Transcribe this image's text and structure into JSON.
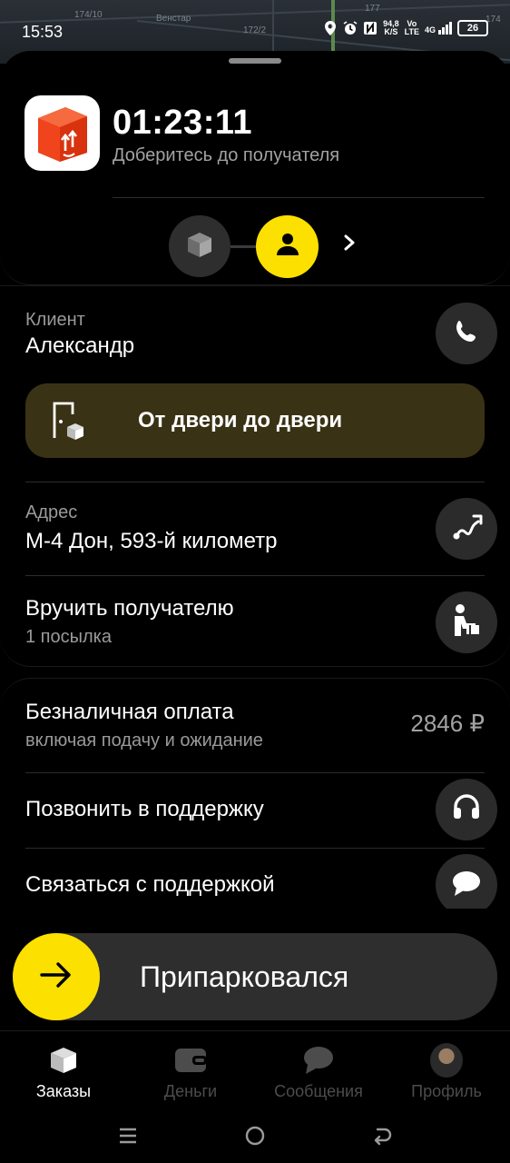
{
  "status_bar": {
    "time": "15:53",
    "map_labels": [
      "174/10",
      "Венстар",
      "172/2",
      "177",
      "174"
    ],
    "speed_value": "94,8",
    "speed_unit": "K/S",
    "volte_top": "Vo",
    "volte_bottom": "LTE",
    "network": "4G",
    "battery": "26",
    "icons": [
      "location-icon",
      "alarm-icon",
      "nfc-icon",
      "signal-icon",
      "battery-icon"
    ]
  },
  "order": {
    "timer": "01:23:11",
    "subtitle": "Доберитесь до получателя",
    "steps": [
      "box-icon",
      "user-icon"
    ]
  },
  "client": {
    "label": "Клиент",
    "name": "Александр",
    "door_to_door": "От двери до двери",
    "address_label": "Адрес",
    "address": "М-4 Дон, 593-й километр",
    "handover_title": "Вручить получателю",
    "handover_sub": "1 посылка"
  },
  "payment": {
    "title": "Безналичная оплата",
    "subtitle": "включая подачу и ожидание",
    "price": "2846 ₽",
    "call_support": "Позвонить в поддержку",
    "chat_support": "Связаться с поддержкой"
  },
  "action": {
    "park_label": "Припарковался"
  },
  "nav": {
    "items": [
      {
        "label": "Заказы",
        "icon": "orders-icon",
        "active": true
      },
      {
        "label": "Деньги",
        "icon": "wallet-icon",
        "active": false
      },
      {
        "label": "Сообщения",
        "icon": "messages-icon",
        "active": false
      },
      {
        "label": "Профиль",
        "icon": "avatar",
        "active": false
      }
    ]
  },
  "colors": {
    "accent": "#fce000",
    "door_bg": "#3a3215",
    "brand_red": "#f0441c"
  }
}
